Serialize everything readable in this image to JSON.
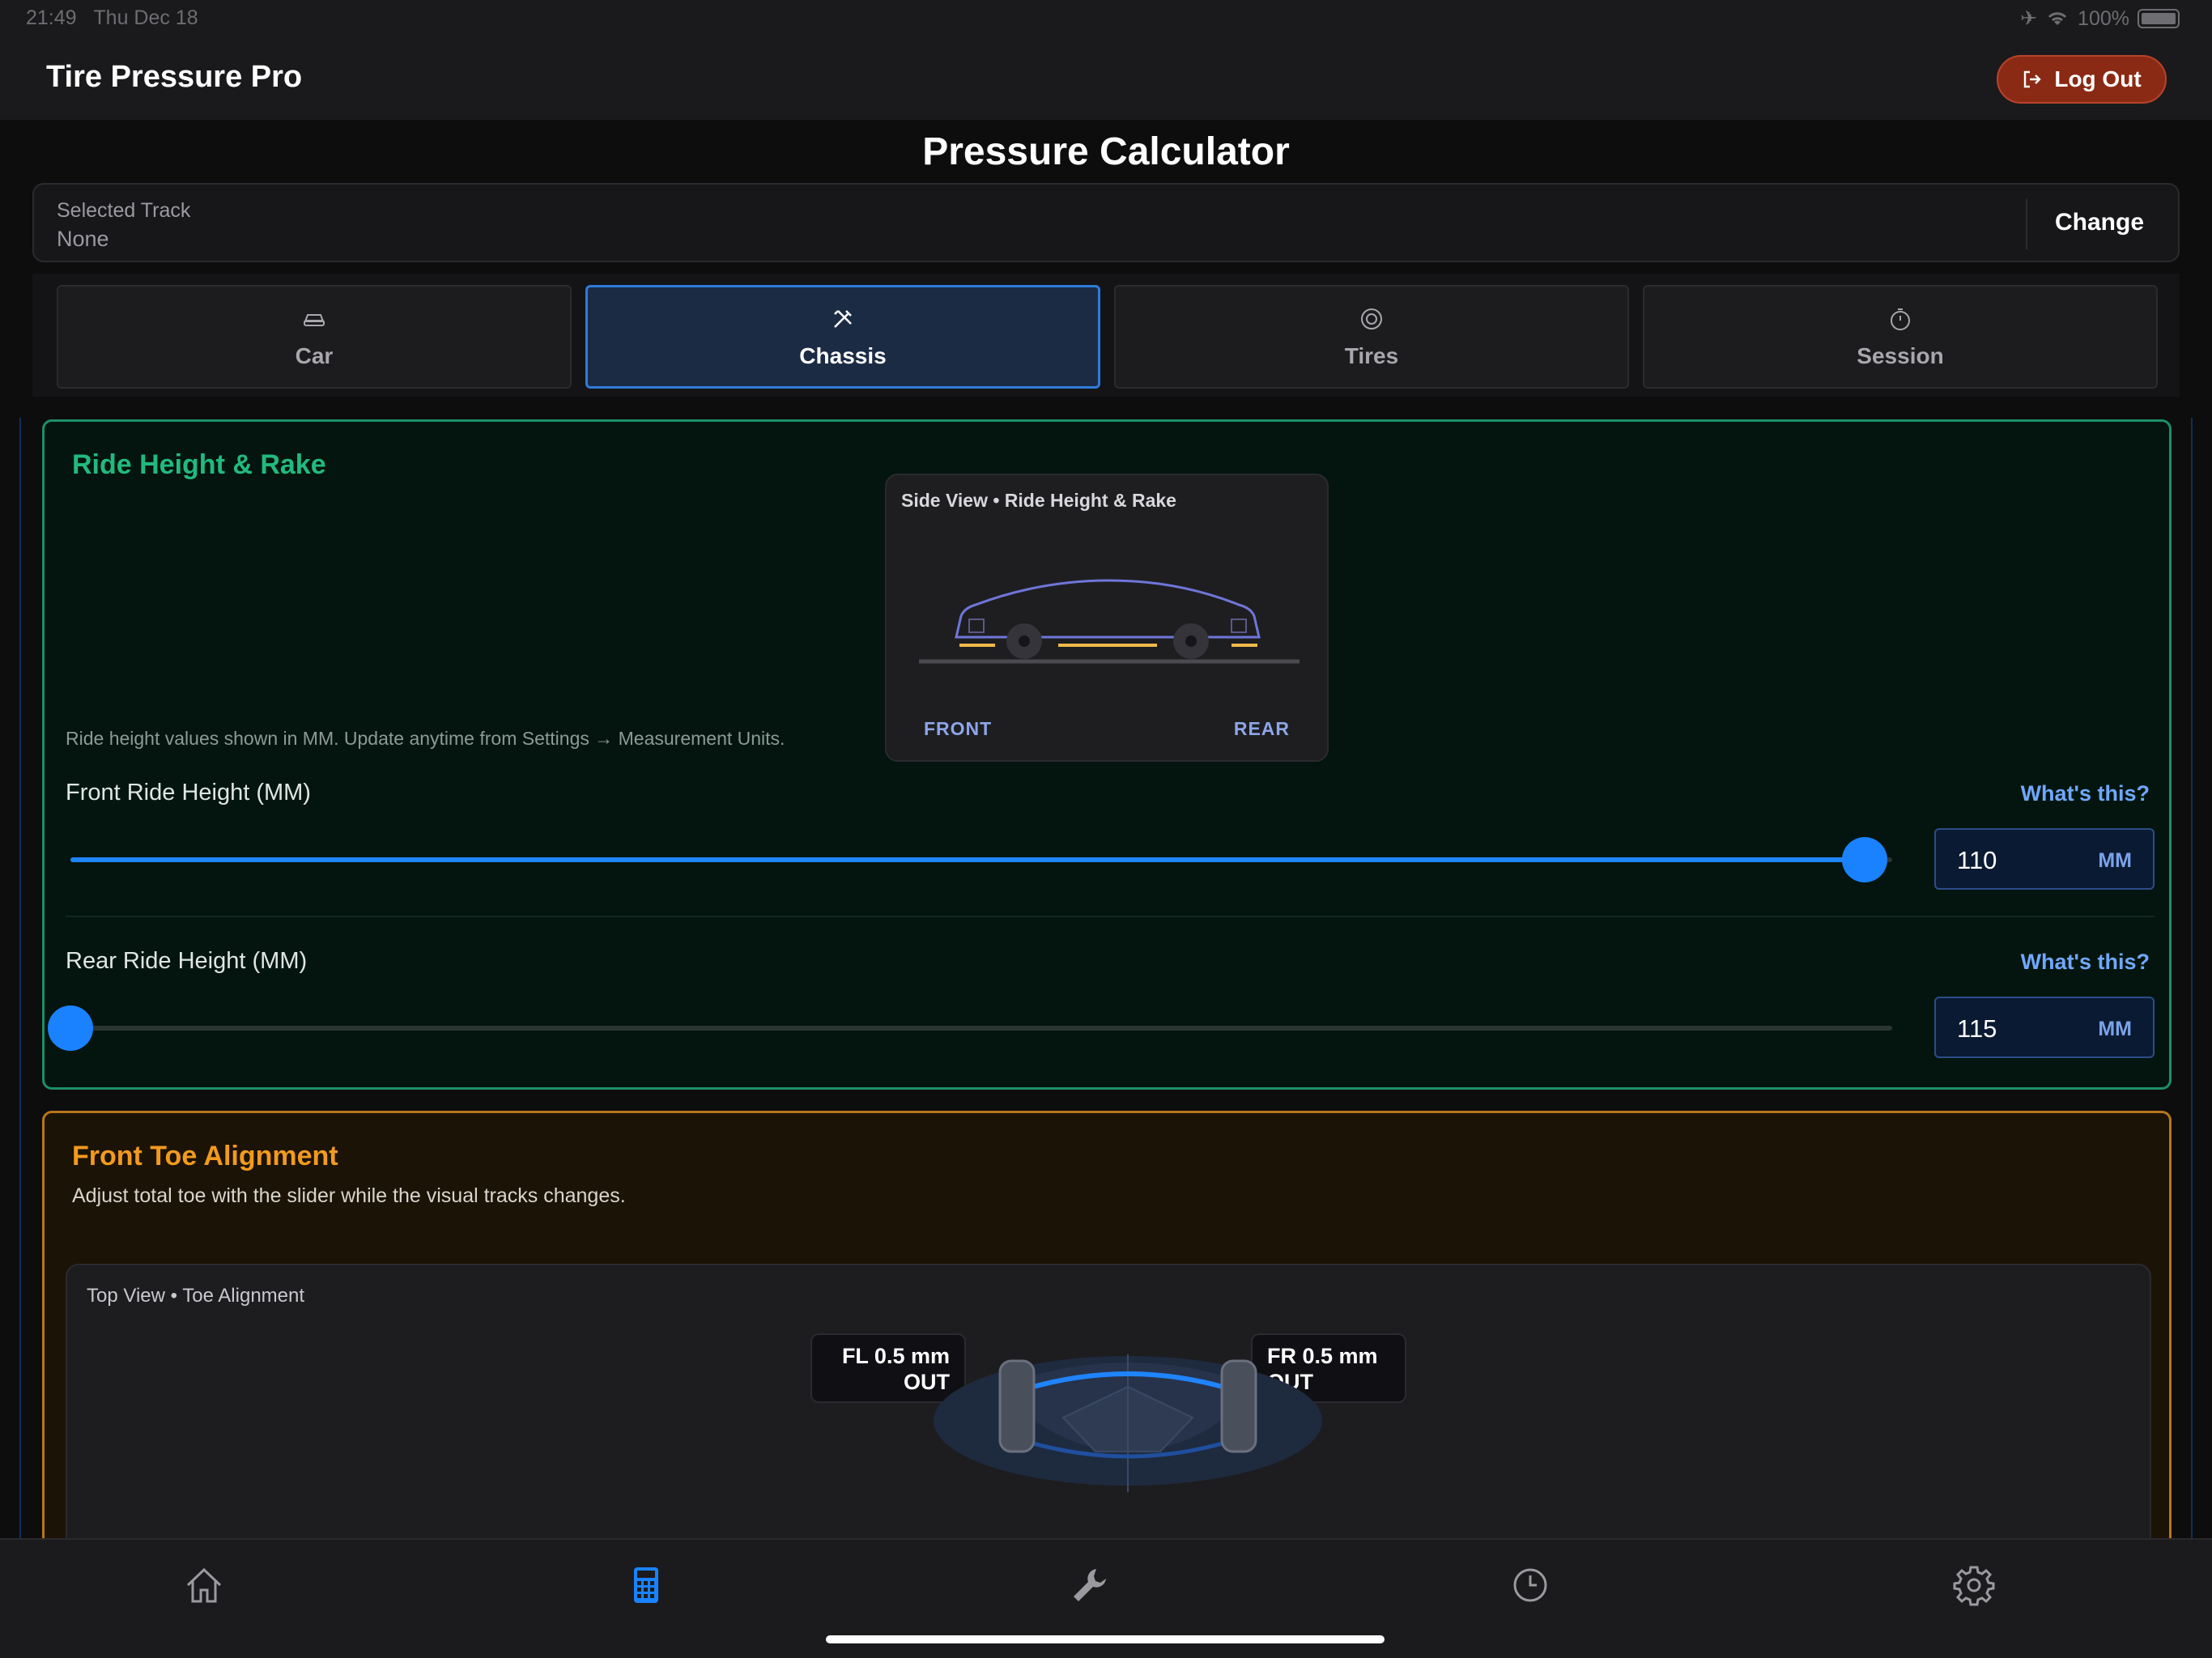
{
  "status": {
    "time": "21:49",
    "date": "Thu Dec 18",
    "battery": "100%"
  },
  "app": {
    "title": "Tire Pressure Pro",
    "logout_label": "Log Out"
  },
  "page": {
    "title": "Pressure Calculator"
  },
  "track": {
    "label": "Selected Track",
    "value": "None",
    "change_label": "Change"
  },
  "tabs": [
    {
      "label": "Car",
      "icon": "car-icon",
      "active": false
    },
    {
      "label": "Chassis",
      "icon": "tools-icon",
      "active": true
    },
    {
      "label": "Tires",
      "icon": "target-icon",
      "active": false
    },
    {
      "label": "Session",
      "icon": "stopwatch-icon",
      "active": false
    }
  ],
  "ride": {
    "title": "Ride Height & Rake",
    "note": "Ride height values shown in MM. Update anytime from Settings → Measurement Units.",
    "side_view": {
      "title": "Side View • Ride Height & Rake",
      "front": "FRONT",
      "rear": "REAR"
    },
    "front": {
      "label": "Front Ride Height (MM)",
      "help": "What's this?",
      "value": "110",
      "unit": "MM",
      "slider_fraction": 0.985
    },
    "rear": {
      "label": "Rear Ride Height (MM)",
      "help": "What's this?",
      "value": "115",
      "unit": "MM",
      "slider_fraction": 0.0
    }
  },
  "toe": {
    "title": "Front Toe Alignment",
    "subtitle": "Adjust total toe with the slider while the visual tracks changes.",
    "view_title": "Top View • Toe Alignment",
    "fl_line1": "FL 0.5 mm",
    "fl_line2": "OUT",
    "fr_line1": "FR 0.5 mm",
    "fr_line2": "OUT"
  },
  "colors": {
    "accent": "#1a82ff",
    "ride_border": "#1e8f67",
    "toe_border": "#b8751d",
    "logout": "#8a2a14"
  },
  "bottom_nav": [
    {
      "icon": "home-icon",
      "active": false
    },
    {
      "icon": "calculator-icon",
      "active": true
    },
    {
      "icon": "wrench-icon",
      "active": false
    },
    {
      "icon": "clock-icon",
      "active": false
    },
    {
      "icon": "gear-icon",
      "active": false
    }
  ]
}
